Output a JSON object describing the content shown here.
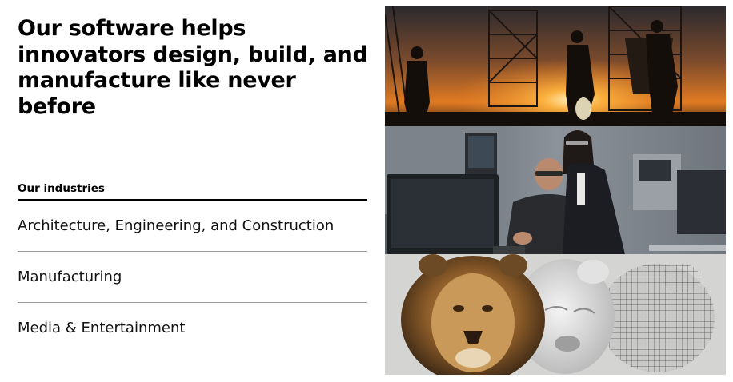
{
  "headline": "Our software helps innovators design, build, and manufacture like never before",
  "industries": {
    "label": "Our industries",
    "items": [
      {
        "label": "Architecture, Engineering, and Construction"
      },
      {
        "label": "Manufacturing"
      },
      {
        "label": "Media & Entertainment"
      }
    ]
  },
  "colors": {
    "text": "#000000",
    "divider": "#9a9a9a",
    "sunset_orange": "#f08a24",
    "lion_gold": "#b9853c"
  },
  "images": [
    {
      "name": "construction-workers-sunset-photo"
    },
    {
      "name": "factory-engineers-computer-photo"
    },
    {
      "name": "lion-3d-render-stages-photo"
    }
  ]
}
